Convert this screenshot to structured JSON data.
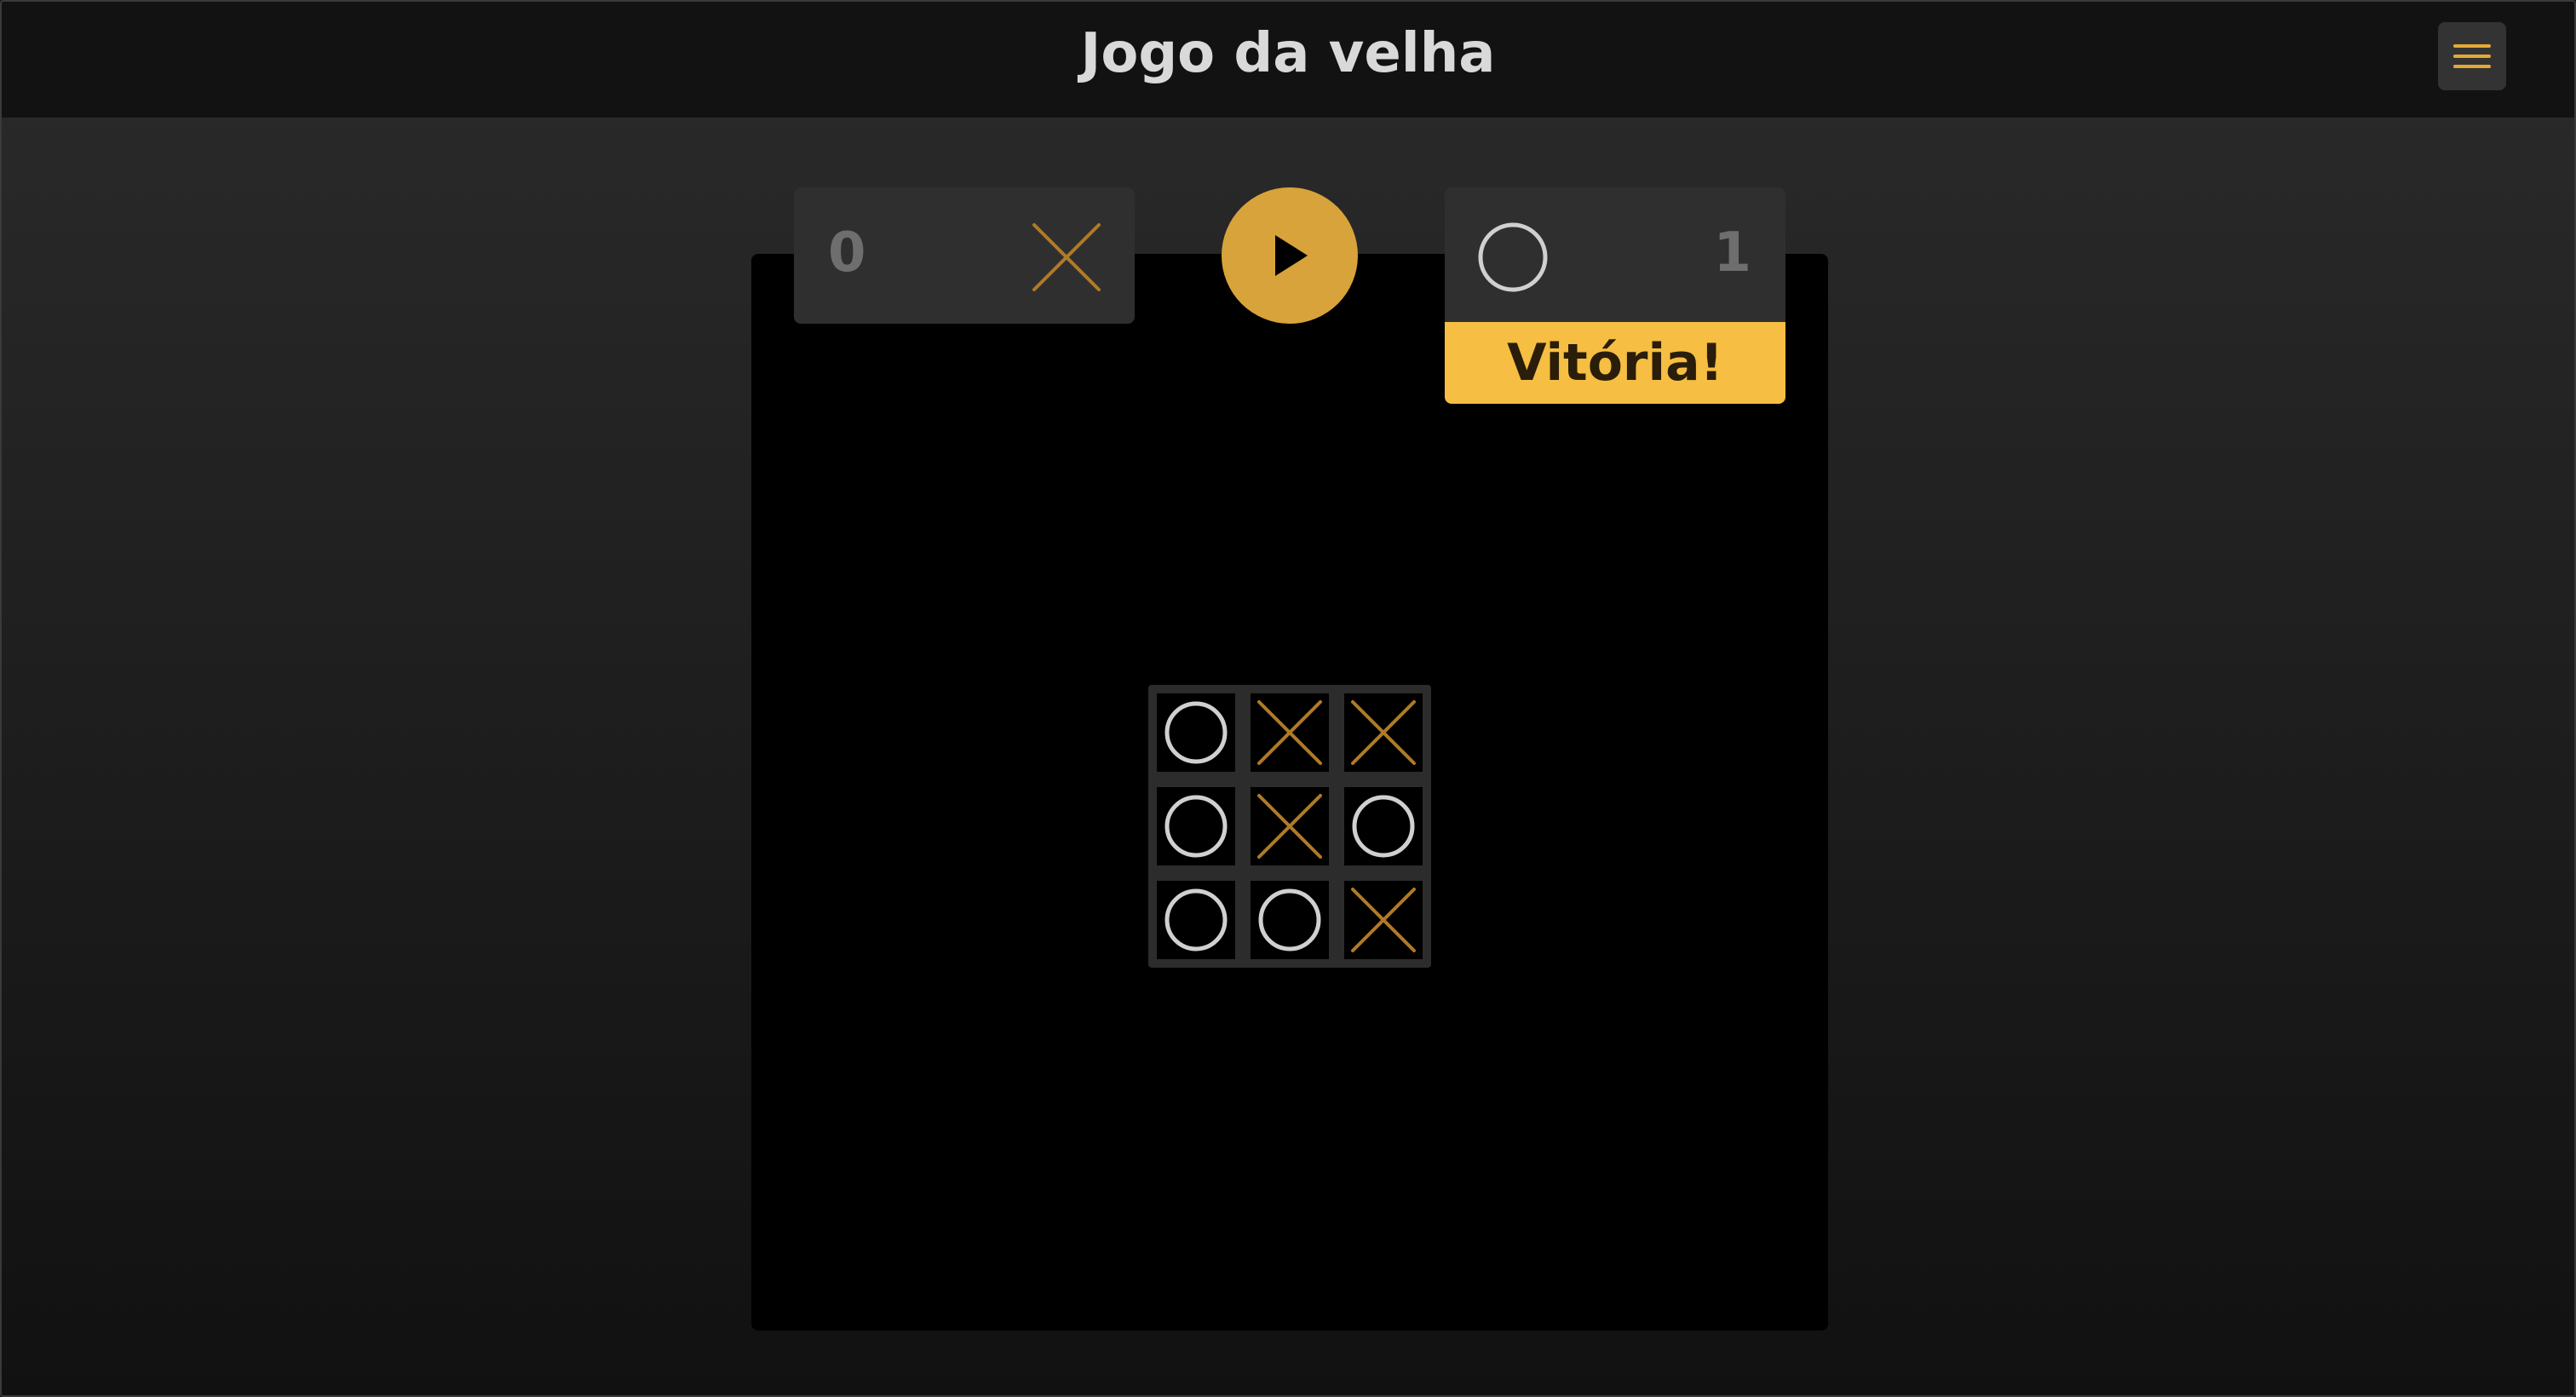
{
  "header": {
    "title": "Jogo da velha",
    "menu_icon": "hamburger-menu-icon"
  },
  "scoreboard": {
    "player_x": {
      "score": "0",
      "mark": "X"
    },
    "player_o": {
      "score": "1",
      "mark": "O"
    },
    "play_icon": "play-icon",
    "win_banner": "Vitória!"
  },
  "board": [
    [
      "O",
      "X",
      "X"
    ],
    [
      "O",
      "X",
      "O"
    ],
    [
      "O",
      "O",
      "X"
    ]
  ],
  "colors": {
    "accent": "#f6be42",
    "x_mark": "#b07a26",
    "o_mark": "#d0d0d0",
    "play_button": "#d8a33a"
  }
}
